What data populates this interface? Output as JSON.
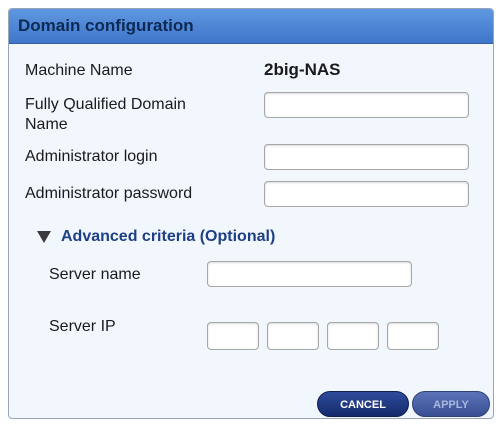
{
  "dialog": {
    "title": "Domain configuration"
  },
  "fields": {
    "machine_name_label": "Machine Name",
    "machine_name_value": "2big-NAS",
    "fqdn_label_line1": "Fully Qualified Domain",
    "fqdn_label_line2": "Name",
    "fqdn_value": "",
    "admin_login_label": "Administrator login",
    "admin_login_value": "",
    "admin_password_label": "Administrator password",
    "admin_password_value": ""
  },
  "advanced": {
    "label": "Advanced criteria (Optional)",
    "expanded": true,
    "server_name_label": "Server name",
    "server_name_value": "",
    "server_ip_label": "Server IP",
    "server_ip_octets": [
      "",
      "",
      "",
      ""
    ]
  },
  "buttons": {
    "cancel_label": "CANCEL",
    "apply_label": "APPLY",
    "apply_enabled": false
  },
  "colors": {
    "title_bar": "#4a84d6",
    "dialog_background": "#f2f7fd",
    "advanced_label": "#1d3f86",
    "cancel_button": "#1c3478",
    "apply_button_disabled": "#4a61a6"
  }
}
